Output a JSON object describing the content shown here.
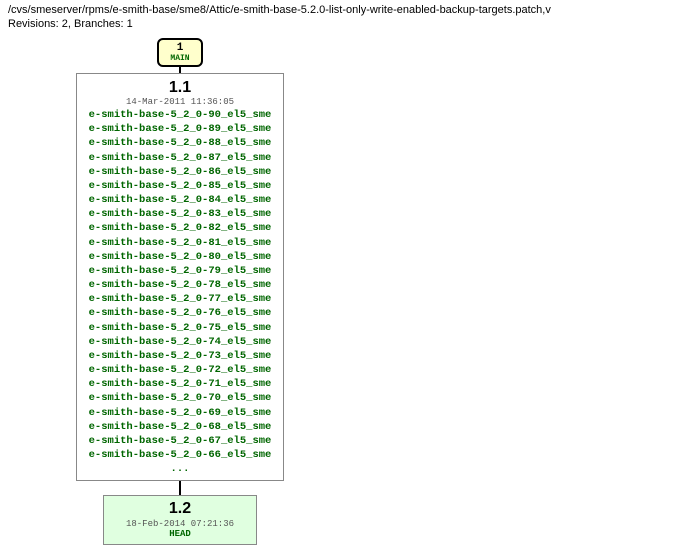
{
  "header": {
    "path": "/cvs/smeserver/rpms/e-smith-base/sme8/Attic/e-smith-base-5.2.0-list-only-write-enabled-backup-targets.patch,v",
    "revisions_line": "Revisions: 2, Branches: 1"
  },
  "main_branch": {
    "index": "1",
    "name": "MAIN"
  },
  "revisions": [
    {
      "number": "1.1",
      "date": "14-Mar-2011 11:36:05",
      "tags": [
        "e-smith-base-5_2_0-90_el5_sme",
        "e-smith-base-5_2_0-89_el5_sme",
        "e-smith-base-5_2_0-88_el5_sme",
        "e-smith-base-5_2_0-87_el5_sme",
        "e-smith-base-5_2_0-86_el5_sme",
        "e-smith-base-5_2_0-85_el5_sme",
        "e-smith-base-5_2_0-84_el5_sme",
        "e-smith-base-5_2_0-83_el5_sme",
        "e-smith-base-5_2_0-82_el5_sme",
        "e-smith-base-5_2_0-81_el5_sme",
        "e-smith-base-5_2_0-80_el5_sme",
        "e-smith-base-5_2_0-79_el5_sme",
        "e-smith-base-5_2_0-78_el5_sme",
        "e-smith-base-5_2_0-77_el5_sme",
        "e-smith-base-5_2_0-76_el5_sme",
        "e-smith-base-5_2_0-75_el5_sme",
        "e-smith-base-5_2_0-74_el5_sme",
        "e-smith-base-5_2_0-73_el5_sme",
        "e-smith-base-5_2_0-72_el5_sme",
        "e-smith-base-5_2_0-71_el5_sme",
        "e-smith-base-5_2_0-70_el5_sme",
        "e-smith-base-5_2_0-69_el5_sme",
        "e-smith-base-5_2_0-68_el5_sme",
        "e-smith-base-5_2_0-67_el5_sme",
        "e-smith-base-5_2_0-66_el5_sme"
      ],
      "ellipsis": "..."
    },
    {
      "number": "1.2",
      "date": "18-Feb-2014 07:21:36",
      "branch_label": "HEAD"
    }
  ]
}
